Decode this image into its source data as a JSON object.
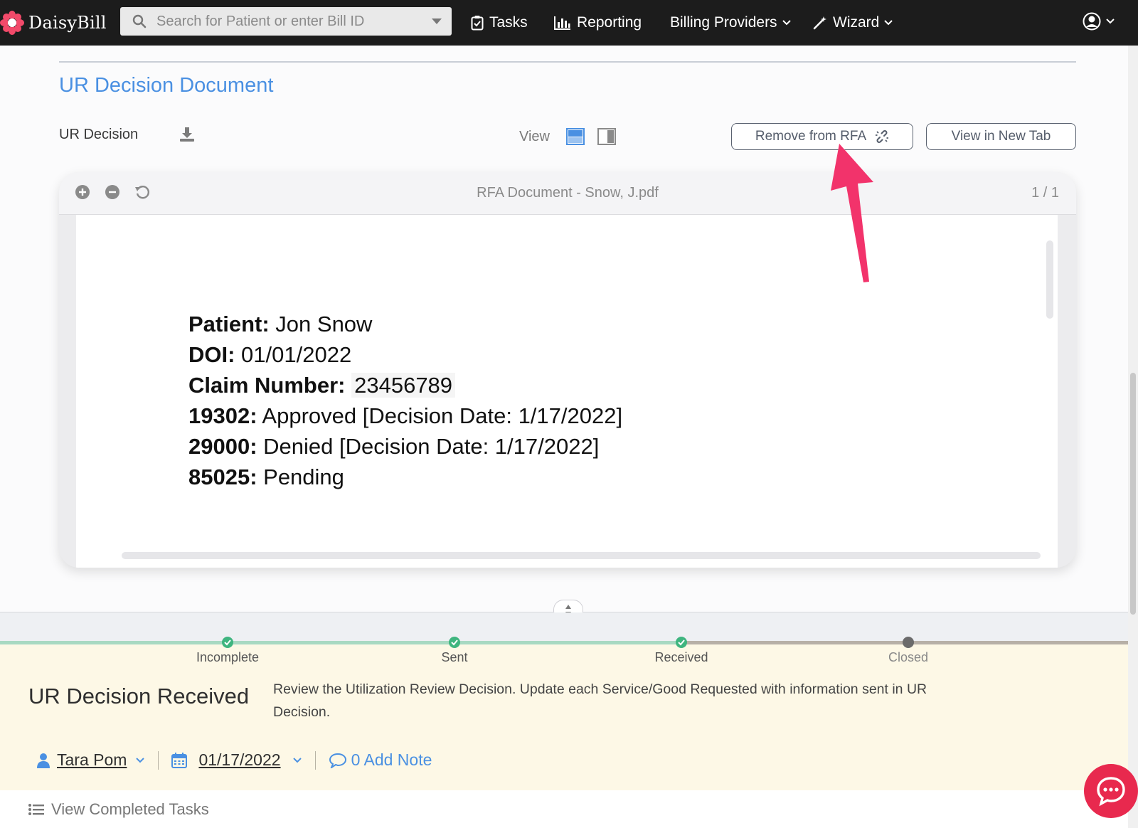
{
  "navbar": {
    "brand": "DaisyBill",
    "search_placeholder": "Search for Patient or enter Bill ID",
    "items": [
      {
        "label": "Tasks"
      },
      {
        "label": "Reporting"
      },
      {
        "label": "Billing Providers"
      },
      {
        "label": "Wizard"
      }
    ]
  },
  "document": {
    "section_title": "UR Decision Document",
    "doc_label": "UR Decision",
    "view_label": "View",
    "remove_button": "Remove from RFA",
    "new_tab_button": "View in New Tab"
  },
  "viewer": {
    "filename": "RFA Document - Snow, J.pdf",
    "page_indicator": "1 / 1",
    "lines": [
      {
        "label": "Patient:",
        "value": " Jon Snow"
      },
      {
        "label": "DOI:",
        "value": " 01/01/2022"
      },
      {
        "label": "Claim Number:",
        "value": "23456789"
      },
      {
        "label": "19302:",
        "value": " Approved [Decision Date: 1/17/2022]"
      },
      {
        "label": "29000:",
        "value": " Denied [Decision Date: 1/17/2022]"
      },
      {
        "label": "85025:",
        "value": " Pending"
      }
    ]
  },
  "progress": {
    "steps": [
      {
        "label": "Incomplete",
        "status": "done"
      },
      {
        "label": "Sent",
        "status": "done"
      },
      {
        "label": "Received",
        "status": "done"
      },
      {
        "label": "Closed",
        "status": "pending"
      }
    ]
  },
  "task": {
    "title": "UR Decision Received",
    "description": "Review the Utilization Review Decision. Update each Service/Good Requested with information sent in UR Decision.",
    "assignee": "Tara Pom",
    "date": "01/17/2022",
    "note_link": "0 Add Note"
  },
  "completed_tasks_label": "View Completed Tasks",
  "colors": {
    "accent_blue": "#4a90e2",
    "navbar_bg": "#1c1c1c",
    "step_done": "#3fb57f",
    "task_panel_bg": "#fdf8e6",
    "arrow_pink": "#f2336b",
    "chat_red": "#e8294e"
  }
}
